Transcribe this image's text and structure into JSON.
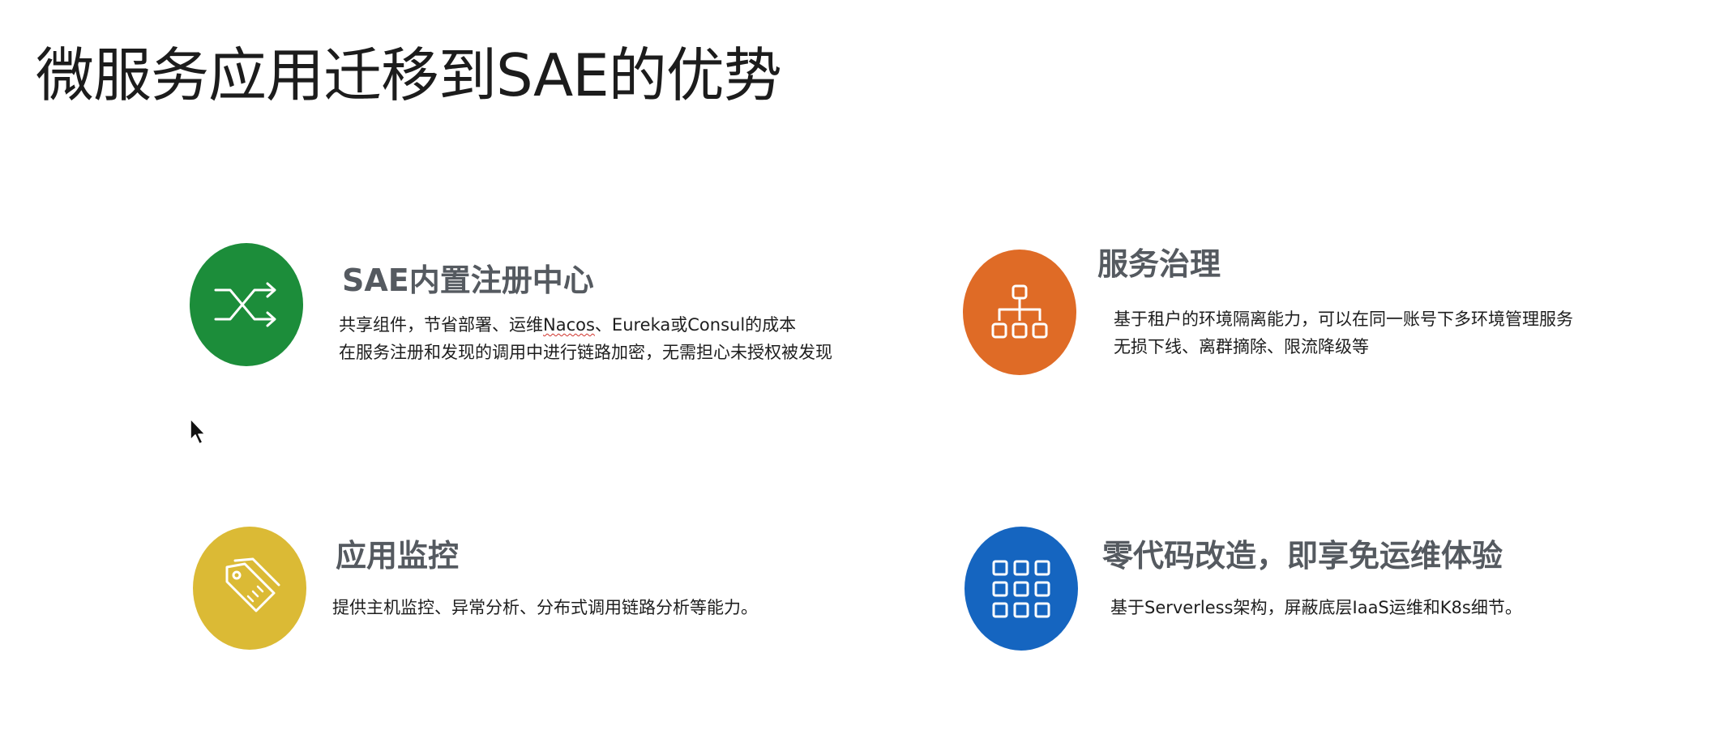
{
  "page": {
    "title": "微服务应用迁移到SAE的优势"
  },
  "colors": {
    "green": "#1c8d3a",
    "orange": "#df6b26",
    "yellow": "#dbba35",
    "blue": "#1565c0",
    "title_gray": "#555a60"
  },
  "features": [
    {
      "title": "SAE内置注册中心",
      "icon": "shuffle-icon",
      "lines": [
        {
          "before": "共享组件，节省部署、运维",
          "marked": "Nacos",
          "after": "、Eureka或Consul的成本"
        },
        {
          "text": "在服务注册和发现的调用中进行链路加密，无需担心未授权被发现"
        }
      ]
    },
    {
      "title": "服务治理",
      "icon": "hierarchy-icon",
      "lines": [
        {
          "text": "基于租户的环境隔离能力，可以在同一账号下多环境管理服务"
        },
        {
          "text": "无损下线、离群摘除、限流降级等"
        }
      ]
    },
    {
      "title": "应用监控",
      "icon": "tag-icon",
      "lines": [
        {
          "text": "提供主机监控、异常分析、分布式调用链路分析等能力。"
        }
      ]
    },
    {
      "title": "零代码改造，即享免运维体验",
      "icon": "grid-icon",
      "lines": [
        {
          "text": "基于Serverless架构，屏蔽底层IaaS运维和K8s细节。"
        }
      ]
    }
  ]
}
